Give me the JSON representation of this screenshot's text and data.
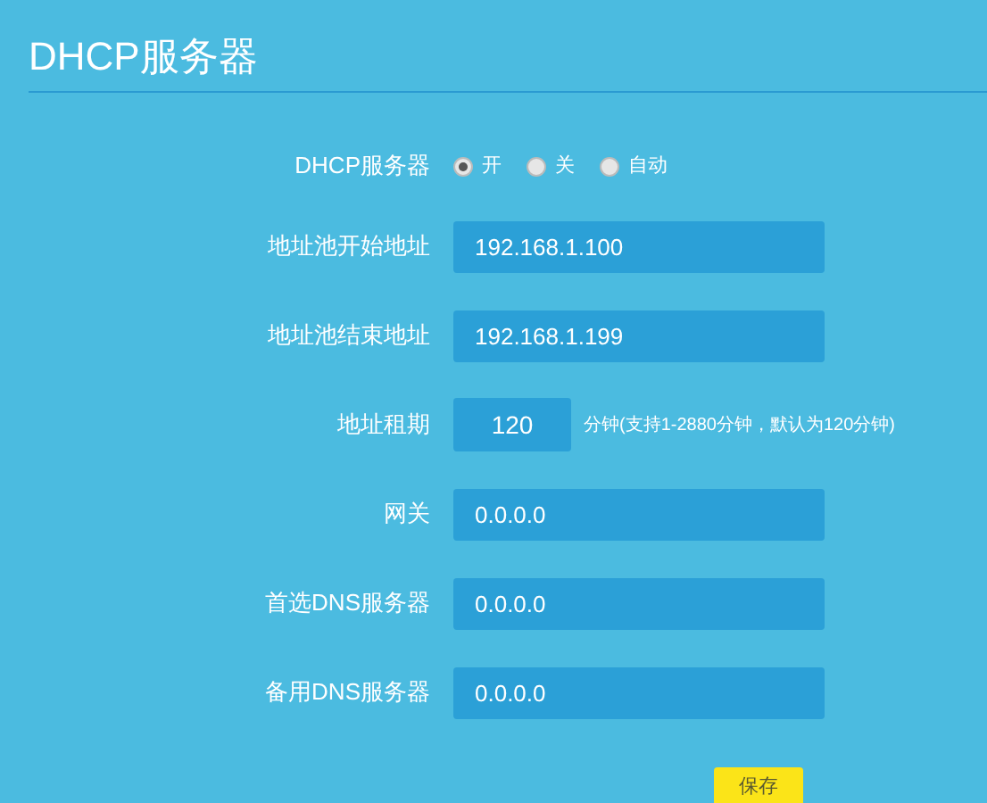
{
  "title": "DHCP服务器",
  "rows": [
    {
      "kind": "radio",
      "label": "DHCP服务器",
      "options": [
        {
          "label": "开",
          "selected": true
        },
        {
          "label": "关",
          "selected": false
        },
        {
          "label": "自动",
          "selected": false
        }
      ]
    },
    {
      "kind": "field",
      "label": "地址池开始地址",
      "value": "192.168.1.100"
    },
    {
      "kind": "field",
      "label": "地址池结束地址",
      "value": "192.168.1.199"
    },
    {
      "kind": "short_field",
      "label": "地址租期",
      "value": "120",
      "note": "分钟(支持1-2880分钟，默认为120分钟)"
    },
    {
      "kind": "field",
      "label": "网关",
      "value": "0.0.0.0"
    },
    {
      "kind": "field",
      "label": "首选DNS服务器",
      "value": "0.0.0.0"
    },
    {
      "kind": "field",
      "label": "备用DNS服务器",
      "value": "0.0.0.0"
    }
  ],
  "save_button": "保存"
}
